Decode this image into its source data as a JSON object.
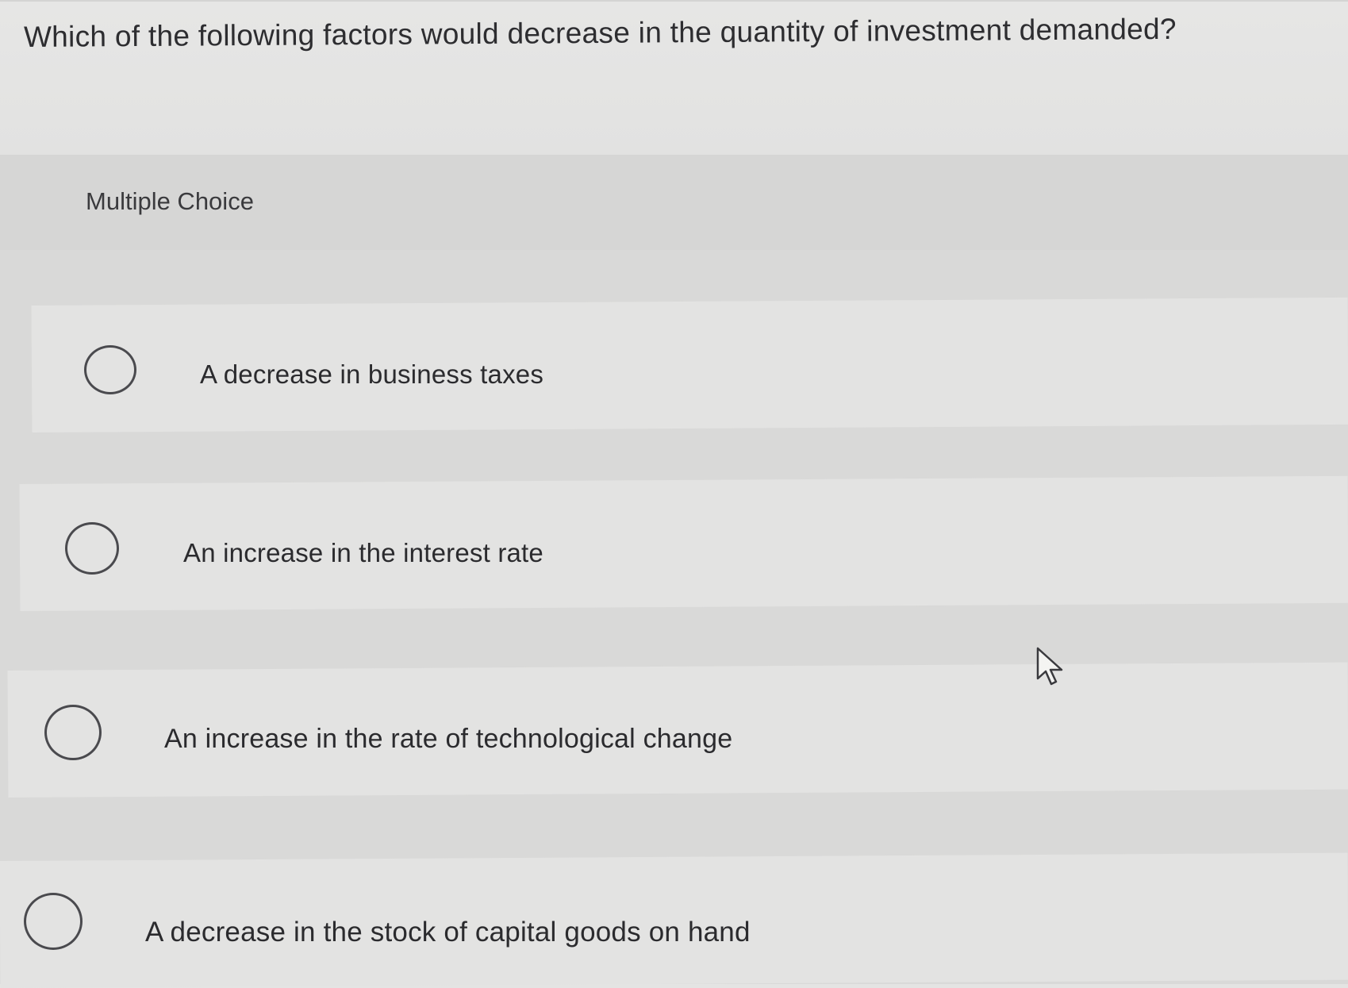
{
  "question": {
    "text": "Which of the following factors would decrease in the quantity of investment demanded?"
  },
  "section": {
    "label": "Multiple Choice"
  },
  "options": [
    {
      "label": "A decrease in business taxes"
    },
    {
      "label": "An increase in the interest rate"
    },
    {
      "label": "An increase in the rate of technological change"
    },
    {
      "label": "A decrease in the stock of capital goods on hand"
    }
  ],
  "icons": {
    "pointer": "mouse-pointer-icon"
  },
  "colors": {
    "background": "#e4e4e3",
    "panel": "#d9d9d8",
    "option_bg": "#e3e3e2",
    "text": "#2b2b2d"
  }
}
